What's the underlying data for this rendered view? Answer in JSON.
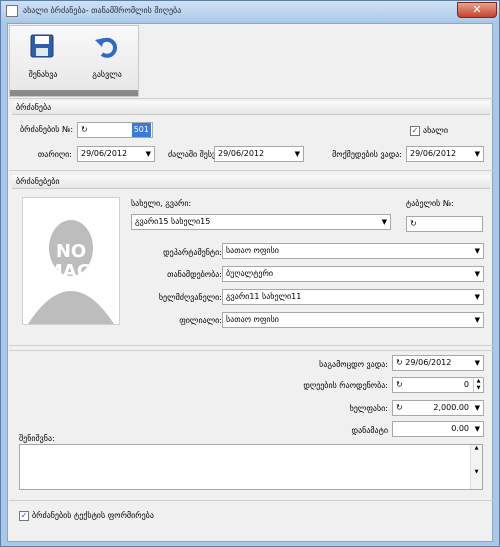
{
  "window": {
    "title": "ახალი ბრძანება- თანამშრომლის მიღება"
  },
  "toolbar": {
    "save_label": "შენახვა",
    "close_label": "გასვლა"
  },
  "order": {
    "section_title": "ბრძანება",
    "number_label": "ბრძანების №:",
    "number_value": "501",
    "new_label": "ახალი",
    "new_checked": true,
    "date_label": "თარიღი:",
    "date_value": "29/06/2012",
    "regime_label": "ძალაში შესვლა:",
    "regime_value": "29/06/2012",
    "effective_label": "მოქმედების ვადა:",
    "effective_value": "29/06/2012"
  },
  "orders": {
    "section_title": "ბრძანებები",
    "photo_text": "NO IMAGE",
    "name_label": "სახელი, გვარი:",
    "name_value": "გვარი15 სახელი15",
    "table_label": "ტაბელის №:",
    "table_value": "",
    "dept_label": "დეპარტამენტი:",
    "dept_value": "სათაო ოფისი",
    "position_label": "თანამდებობა:",
    "position_value": "ბუღალტერი",
    "manager_label": "ხელმძღვანელი:",
    "manager_value": "გვარი11 სახელი11",
    "branch_label": "ფილიალი:",
    "branch_value": "სათაო ოფისი"
  },
  "details": {
    "probation_label": "საგამოცდო ვადა:",
    "probation_value": "29/06/2012",
    "vacation_label": "დღეების რაოდენობა:",
    "vacation_value": "0",
    "salary_label": "ხელფასი:",
    "salary_value": "2,000.00",
    "bonus_label": "დანამატი",
    "bonus_value": "0.00",
    "notes_label": "შენიშვნა:"
  },
  "footer": {
    "print_label": "ბრძანების ტექსტის ფორმირება",
    "print_checked": true
  },
  "icons": {
    "refresh": "refresh-icon",
    "calendar": "calendar-icon",
    "dropdown": "chevron-down-icon"
  }
}
